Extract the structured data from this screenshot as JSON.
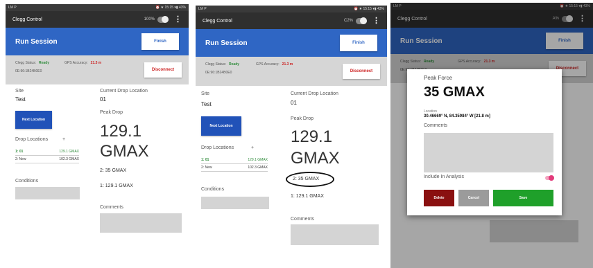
{
  "status_bar": {
    "left": "LM P",
    "right": "⏰ ★ 15:15 ▾▮ 43%"
  },
  "app": {
    "title": "Clegg Control",
    "battery": "100%"
  },
  "app2": {
    "battery": "C2% "
  },
  "app3": {
    "title": "Clegg Control",
    "battery": "A% "
  },
  "session": {
    "title": "Run Session",
    "finish_label": "Finish",
    "clegg_status_label": "Clegg Status:",
    "clegg_status_value": "Ready",
    "gps_label": "GPS Accuracy:",
    "gps_value": "21.3 m",
    "device_id": "0E:96:1B24B0E0",
    "disconnect_label": "Disconnect"
  },
  "site": {
    "label": "Site",
    "value": "Test"
  },
  "current_drop": {
    "label": "Current Drop Location",
    "value": "01"
  },
  "next_location_label": "Next Location",
  "drop_locations": {
    "label": "Drop Locations",
    "add_symbol": "+",
    "items": [
      {
        "name": "1: 01",
        "value": "129.1 GMAX"
      },
      {
        "name": "2: New",
        "value": "102.3 GMAX"
      }
    ]
  },
  "peak_drop": {
    "label": "Peak Drop",
    "value": "129.1",
    "unit": "GMAX"
  },
  "drops": [
    "2: 35 GMAX",
    "1: 129.1 GMAX"
  ],
  "conditions_label": "Conditions",
  "comments_label": "Comments",
  "dialog": {
    "title": "Peak Force",
    "force": "35 GMAX",
    "location_label": "Location",
    "location_value": "30.46669° N, 84.35984° W [21.8 m]",
    "comments_label": "Comments",
    "include_label": "Include In Analysis",
    "delete_label": "Delete",
    "cancel_label": "Cancel",
    "save_label": "Save"
  },
  "colors": {
    "accent_blue": "#2f66c4",
    "status_green": "#2e8b3a",
    "alert_red": "#cc2222",
    "delete_red": "#8a1010",
    "save_green": "#1fa02a",
    "toggle_pink": "#e23a7a"
  }
}
